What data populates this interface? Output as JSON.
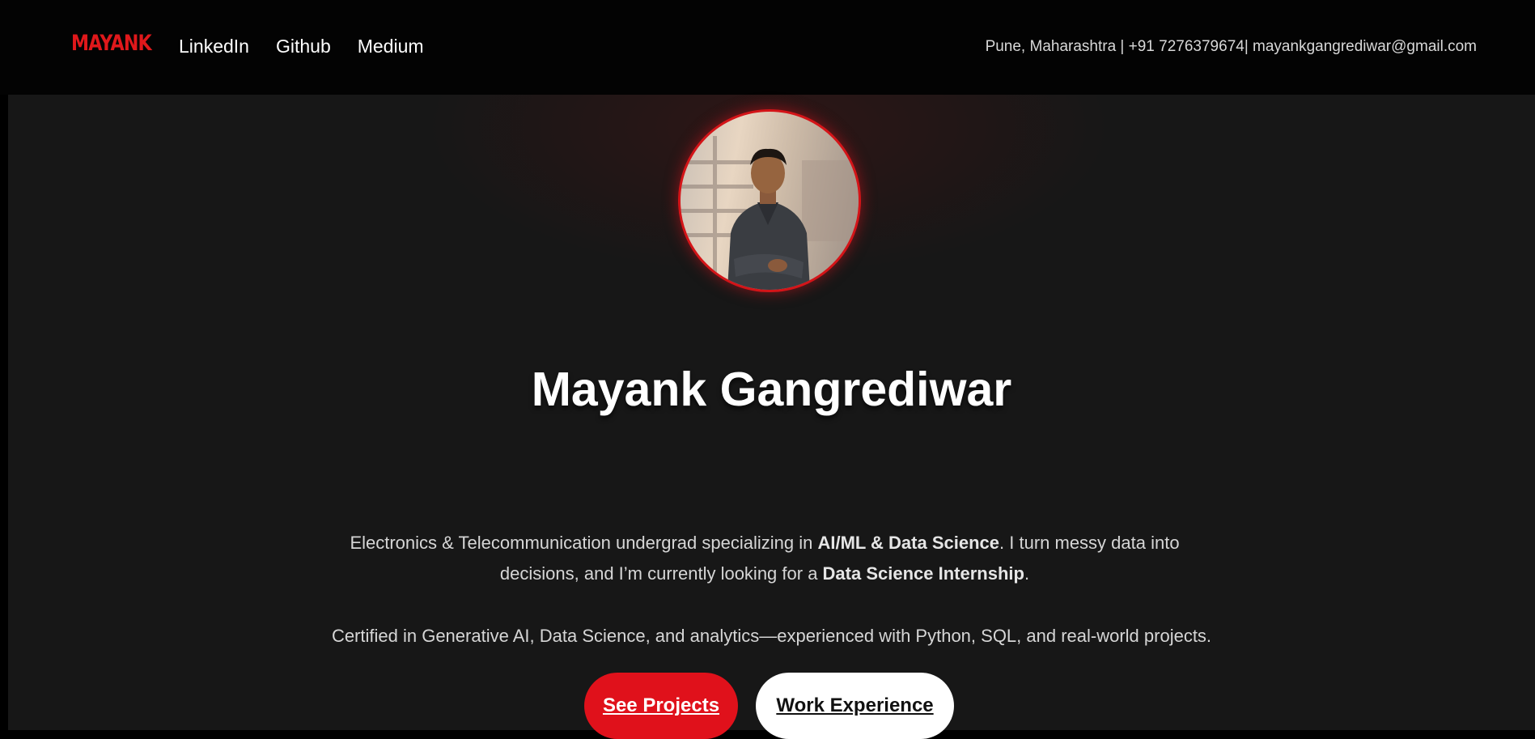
{
  "nav": {
    "brand": "MAYANK",
    "links": [
      "LinkedIn",
      "Github",
      "Medium"
    ],
    "contact": "Pune, Maharashtra | +91 7276379674| mayankgangrediwar@gmail.com"
  },
  "hero": {
    "name": "Mayank Gangrediwar",
    "bio": {
      "part1": "Electronics & Telecommunication undergrad specializing in ",
      "bold1": "AI/ML & Data Science",
      "part2": ". I turn messy data into decisions, and I’m currently looking for a ",
      "bold2": "Data Science Internship",
      "part3": "."
    },
    "cert": "Certified in Generative AI, Data Science, and analytics—experienced with Python, SQL, and real-world projects.",
    "buttons": {
      "projects": "See Projects",
      "experience": "Work Experience"
    }
  },
  "colors": {
    "accent": "#e0111b",
    "background": "#171717",
    "navbar": "#030303"
  }
}
